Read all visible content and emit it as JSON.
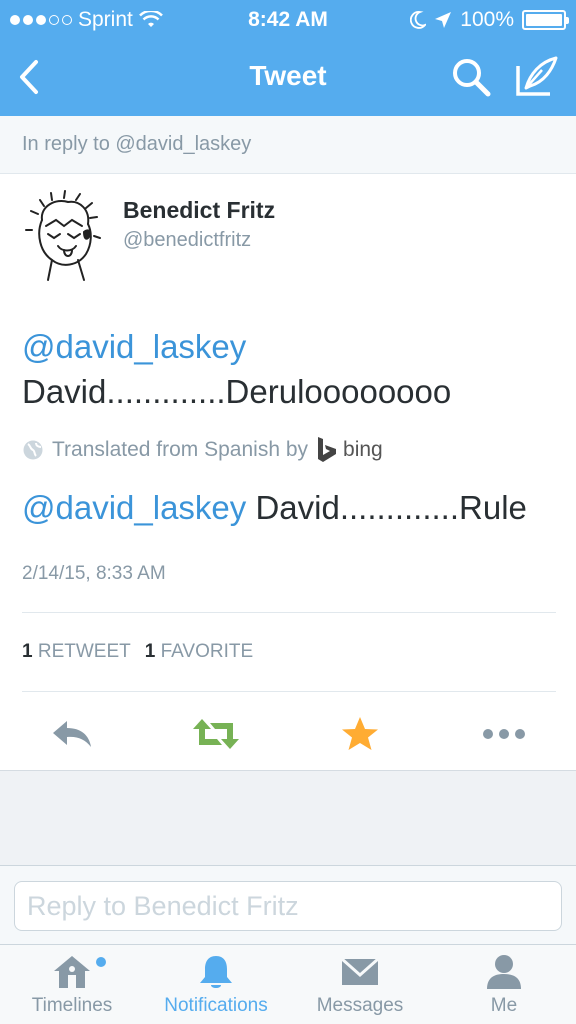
{
  "status_bar": {
    "carrier": "Sprint",
    "time": "8:42 AM",
    "battery": "100%",
    "signal_bars_filled": 3,
    "signal_bars_total": 5
  },
  "nav": {
    "title": "Tweet",
    "back_icon": "chevron-left-icon",
    "search_icon": "search-icon",
    "compose_icon": "compose-icon"
  },
  "reply_context": "In reply to @david_laskey",
  "tweet": {
    "author_name": "Benedict Fritz",
    "author_handle": "@benedictfritz",
    "mention": "@david_laskey",
    "body": "David.............Deruloooooooo",
    "translated_label": "Translated from Spanish by",
    "translator": "bing",
    "translation_mention": "@david_laskey",
    "translation_body": " David.............Rule",
    "timestamp": "2/14/15, 8:33 AM",
    "retweet_count": "1",
    "retweet_label": "RETWEET",
    "favorite_count": "1",
    "favorite_label": "FAVORITE"
  },
  "colors": {
    "brand_blue": "#55acee",
    "link_blue": "#3b94d9",
    "retweet_green": "#77b255",
    "favorite_orange": "#ffac33",
    "muted_gray": "#8899a6"
  },
  "reply": {
    "placeholder": "Reply to Benedict Fritz"
  },
  "tabs": [
    {
      "label": "Timelines",
      "icon": "home-icon"
    },
    {
      "label": "Notifications",
      "icon": "bell-icon"
    },
    {
      "label": "Messages",
      "icon": "envelope-icon"
    },
    {
      "label": "Me",
      "icon": "person-icon"
    }
  ]
}
